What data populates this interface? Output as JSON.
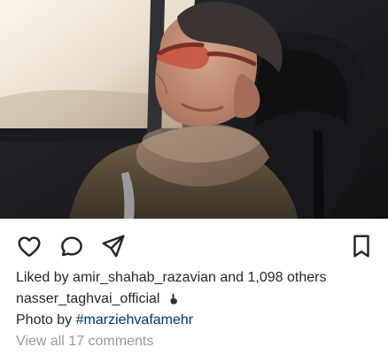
{
  "post": {
    "icons": {
      "like": "heart-icon",
      "comment": "comment-icon",
      "share": "send-icon",
      "save": "bookmark-icon"
    },
    "likes": {
      "prefix": "Liked by",
      "user": "amir_shahab_razavian",
      "and": "and",
      "count": "1,098",
      "suffix": "others"
    },
    "caption": {
      "user": "nasser_taghvai_official",
      "emoji": "pointing-up-dark-skin-emoji"
    },
    "photo_by": {
      "label": "Photo by",
      "tag": "#marziehvafamehr"
    },
    "comments": {
      "view_all_text": "View all 17 comments"
    },
    "colors": {
      "text": "#262626",
      "secondary": "#999999",
      "link": "#003569",
      "background": "#ffffff"
    }
  }
}
